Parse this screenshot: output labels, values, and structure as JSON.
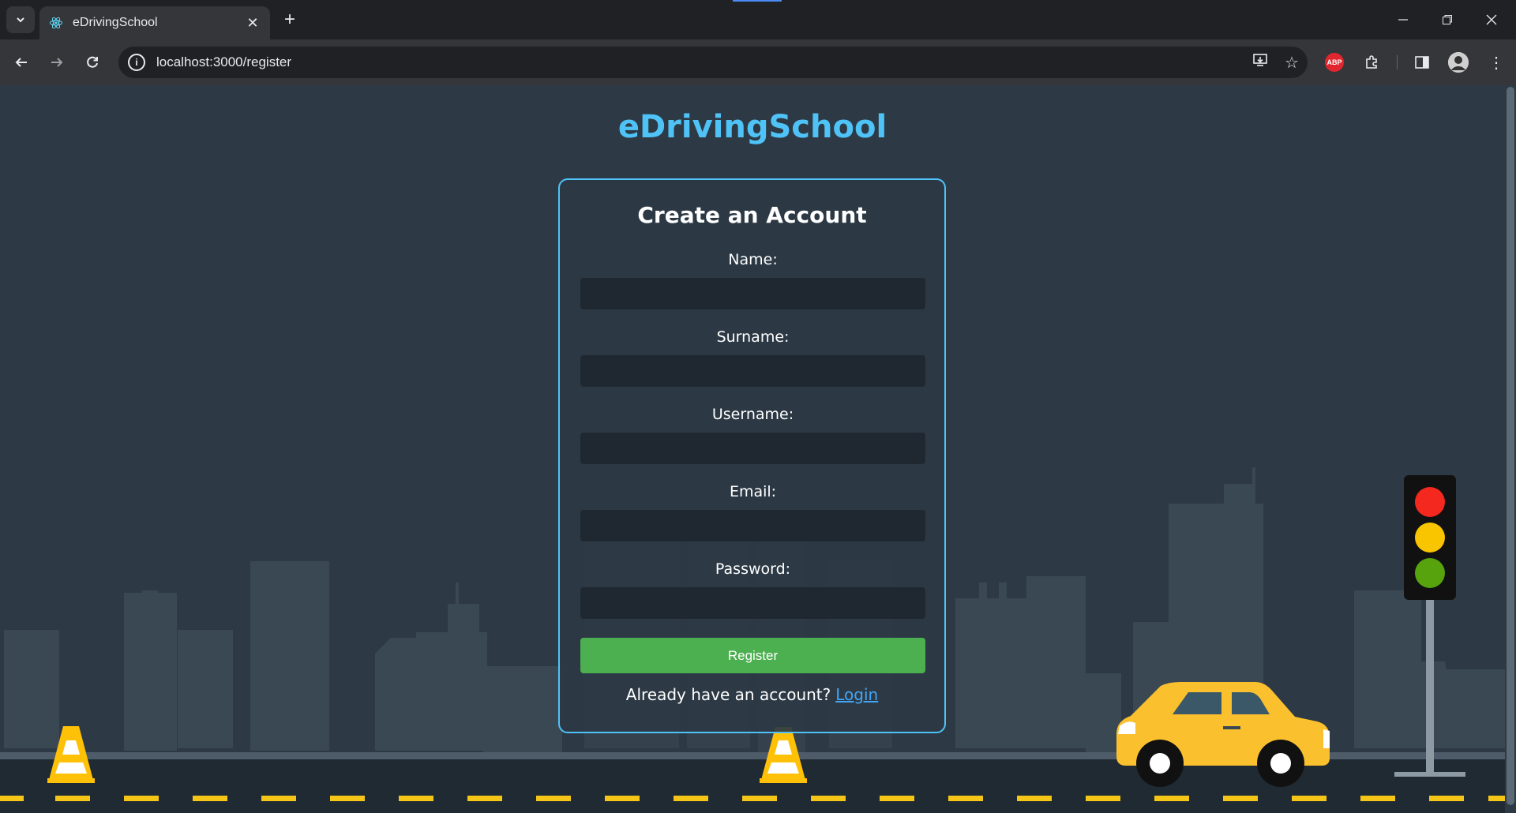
{
  "browser": {
    "tab_title": "eDrivingSchool",
    "url": "localhost:3000/register",
    "abp_label": "ABP",
    "icons": {
      "tab_list": "chevron-down-icon",
      "favicon": "react-icon",
      "tab_close": "close-icon",
      "new_tab": "plus-icon",
      "back": "arrow-left-icon",
      "forward": "arrow-right-icon",
      "reload": "reload-icon",
      "site_info": "info-icon",
      "install": "install-app-icon",
      "bookmark": "star-icon",
      "extensions": "puzzle-icon",
      "side_panel": "side-panel-icon",
      "profile": "avatar-icon",
      "menu": "kebab-menu-icon",
      "minimize": "minimize-icon",
      "restore": "restore-icon",
      "close_window": "close-icon"
    }
  },
  "page": {
    "app_title": "eDrivingSchool",
    "form": {
      "heading": "Create an Account",
      "fields": [
        {
          "label": "Name:",
          "value": ""
        },
        {
          "label": "Surname:",
          "value": ""
        },
        {
          "label": "Username:",
          "value": ""
        },
        {
          "label": "Email:",
          "value": ""
        },
        {
          "label": "Password:",
          "value": ""
        }
      ],
      "submit_label": "Register",
      "login_prompt": "Already have an account?",
      "login_link": "Login"
    }
  },
  "colors": {
    "background": "#2d3a45",
    "accent": "#4fc3f7",
    "button": "#4caf50",
    "link": "#42a5f5",
    "road": "#1f2a33",
    "lane_marking": "#f5c518",
    "car": "#fbc02d",
    "traffic_light_red": "#f4281e",
    "traffic_light_yellow": "#f9c400",
    "traffic_light_green": "#57a30d"
  }
}
